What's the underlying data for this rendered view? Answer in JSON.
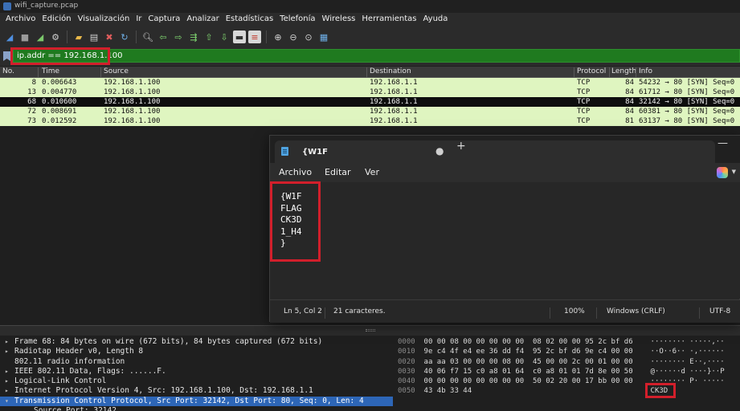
{
  "window": {
    "title": "wifi_capture.pcap"
  },
  "menubar": [
    "Archivo",
    "Edición",
    "Visualización",
    "Ir",
    "Captura",
    "Analizar",
    "Estadísticas",
    "Telefonía",
    "Wireless",
    "Herramientas",
    "Ayuda"
  ],
  "filter": {
    "value": "ip.addr == 192.168.1.100"
  },
  "packet_list": {
    "columns": [
      "No.",
      "Time",
      "Source",
      "Destination",
      "Protocol",
      "Length",
      "Info"
    ],
    "rows": [
      {
        "no": "8",
        "time": "0.006643",
        "source": "192.168.1.100",
        "destination": "192.168.1.1",
        "protocol": "TCP",
        "length": "84",
        "info": "54232 → 80 [SYN] Seq=0"
      },
      {
        "no": "13",
        "time": "0.004770",
        "source": "192.168.1.100",
        "destination": "192.168.1.1",
        "protocol": "TCP",
        "length": "84",
        "info": "61712 → 80 [SYN] Seq=0"
      },
      {
        "no": "68",
        "time": "0.010600",
        "source": "192.168.1.100",
        "destination": "192.168.1.1",
        "protocol": "TCP",
        "length": "84",
        "info": "32142 → 80 [SYN] Seq=0"
      },
      {
        "no": "72",
        "time": "0.008691",
        "source": "192.168.1.100",
        "destination": "192.168.1.1",
        "protocol": "TCP",
        "length": "84",
        "info": "60381 → 80 [SYN] Seq=0"
      },
      {
        "no": "73",
        "time": "0.012592",
        "source": "192.168.1.100",
        "destination": "192.168.1.1",
        "protocol": "TCP",
        "length": "81",
        "info": "63137 → 80 [SYN] Seq=0"
      }
    ],
    "selected_index": 2
  },
  "details": [
    {
      "text": "Frame 68: 84 bytes on wire (672 bits), 84 bytes captured (672 bits)",
      "arrow": "▸"
    },
    {
      "text": "Radiotap Header v0, Length 8",
      "arrow": "▸"
    },
    {
      "text": "802.11 radio information",
      "arrow": ""
    },
    {
      "text": "IEEE 802.11 Data, Flags: ......F.",
      "arrow": "▸"
    },
    {
      "text": "Logical-Link Control",
      "arrow": "▸"
    },
    {
      "text": "Internet Protocol Version 4, Src: 192.168.1.100, Dst: 192.168.1.1",
      "arrow": "▸"
    },
    {
      "text": "Transmission Control Protocol, Src Port: 32142, Dst Port: 80, Seq: 0, Len: 4",
      "arrow": "▾"
    },
    {
      "text": "Source Port: 32142",
      "arrow": ""
    }
  ],
  "hex": [
    {
      "offset": "0000",
      "bytes": "00 00 08 00 00 00 00 00  08 02 00 00 95 2c bf d6",
      "ascii": "········ ·····,··"
    },
    {
      "offset": "0010",
      "bytes": "9e c4 4f e4 ee 36 dd f4  95 2c bf d6 9e c4 00 00",
      "ascii": "··O··6·· ·,······"
    },
    {
      "offset": "0020",
      "bytes": "aa aa 03 00 00 00 08 00  45 00 00 2c 00 01 00 00",
      "ascii": "········ E··,····"
    },
    {
      "offset": "0030",
      "bytes": "40 06 f7 15 c0 a8 01 64  c0 a8 01 01 7d 8e 00 50",
      "ascii": "@······d ····}··P"
    },
    {
      "offset": "0040",
      "bytes": "00 00 00 00 00 00 00 00  50 02 20 00 17 bb 00 00",
      "ascii": "········ P· ·····"
    },
    {
      "offset": "0050",
      "bytes": "43 4b 33 44",
      "ascii": "CK3D"
    }
  ],
  "notepad": {
    "tab_title": "{W1F",
    "tab_dot": "●",
    "new_tab": "+",
    "minimize": "—",
    "menu": [
      "Archivo",
      "Editar",
      "Ver"
    ],
    "content": "{W1F\nFLAG\nCK3D\n1_H4\n}",
    "status": {
      "position": "Ln 5, Col 2",
      "chars": "21 caracteres.",
      "zoom": "100%",
      "eol": "Windows (CRLF)",
      "encoding": "UTF-8"
    }
  },
  "colors": {
    "filter_bg": "#1f7a1f",
    "row_bg": "#dff5c0",
    "highlight_red": "#d21f2b",
    "selected_detail": "#2d66b7"
  }
}
